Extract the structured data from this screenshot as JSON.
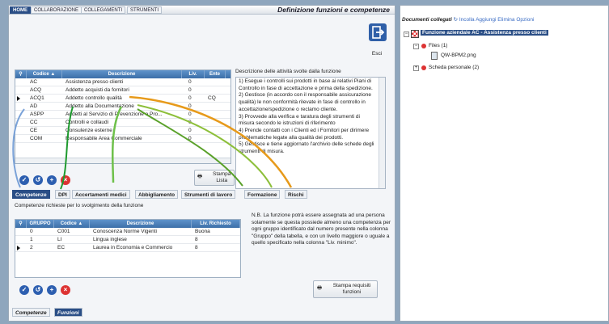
{
  "top_tabs": [
    "HOME",
    "COLLABORAZIONE",
    "COLLEGAMENTI",
    "STRUMENTI"
  ],
  "title": "Definizione funzioni e competenze",
  "exit_label": "Esci",
  "grid1": {
    "headers": [
      "Codice",
      "Descrizione",
      "Liv.",
      "Ente"
    ],
    "rows": [
      [
        "AC",
        "Assistenza presso clienti",
        "0",
        ""
      ],
      [
        "ACQ",
        "Addetto acquisti da fornitori",
        "0",
        ""
      ],
      [
        "ACQ1",
        "Addetto controllo qualità",
        "0",
        "CQ"
      ],
      [
        "AD",
        "Addetto alla Documentazione",
        "0",
        ""
      ],
      [
        "ASPP",
        "Addetti al Servizio di Prevenzione e Pro...",
        "0",
        ""
      ],
      [
        "CC",
        "Controlli e collaudi",
        "0",
        ""
      ],
      [
        "CE",
        "Consulenze esterne",
        "0",
        ""
      ],
      [
        "COM",
        "Responsabile Area Commerciale",
        "0",
        ""
      ]
    ],
    "selected_index": 2
  },
  "desc_label": "Descrizione delle attività svolte dalla funzione",
  "desc_text": "1) Esegue i controlli  sui prodotti  in base ai relativi Piani di Controllo in fase di accettazione e prima della spedizione.\n2) Gestisce (in accordo  con il responsabile assicurazione qualità) le  non conformità rilevate in fase di controllo in accettazione/spedizione o reclamo cliente.\n3) Provvede alla verifica e taratura degli strumenti di misura secondo le istruzioni di riferimento\n4) Prende contatti con i Clienti ed i Fornitori per dirimere problematiche legate alla qualità dei prodotti.\n5) Gestisce e tiene aggiornato l'archivio delle schede degli strumenti di misura.",
  "print_list": "Stampa\nLista",
  "tabs2": [
    "Competenze",
    "DPI",
    "Accertamenti medici",
    "Abbigliamento",
    "Strumenti di lavoro",
    "Formazione",
    "Rischi"
  ],
  "grid2_caption": "Competenze richieste per lo svolgimento della funzione",
  "grid2": {
    "headers": [
      "GRUPPO",
      "Codice",
      "Descrizione",
      "Liv. Richiesto"
    ],
    "rows": [
      [
        "0",
        "C001",
        "Conoscenza Norme Vigenti",
        "Buona"
      ],
      [
        "1",
        "LI",
        "Lingua inglese",
        "8"
      ],
      [
        "2",
        "EC",
        "Laurea in Economia e Commercio",
        "8"
      ]
    ],
    "selected_index": 2
  },
  "note": "N.B. La funzione potrà essere assegnata ad una persona solamente se questa possiede almeno una competenza per ogni gruppo identificato dal numero presente nella colonna \"Gruppo\" della tabella, e con un livello maggiore o uguale a quello specificato nella colonna \"Liv. minimo\".",
  "print_req": "Stampa requisiti\nfunzioni",
  "bottom_tabs": [
    "Competenze",
    "Funzioni"
  ],
  "right": {
    "header": "Documenti collegati",
    "links": [
      "Incolla",
      "Aggiungi",
      "Elimina",
      "Opzioni"
    ],
    "root": "Funzione aziendale AC - Assistenza presso clienti",
    "files": "Files (1)",
    "file": "QW-BPM2.png",
    "scheda": "Scheda personale (2)"
  }
}
